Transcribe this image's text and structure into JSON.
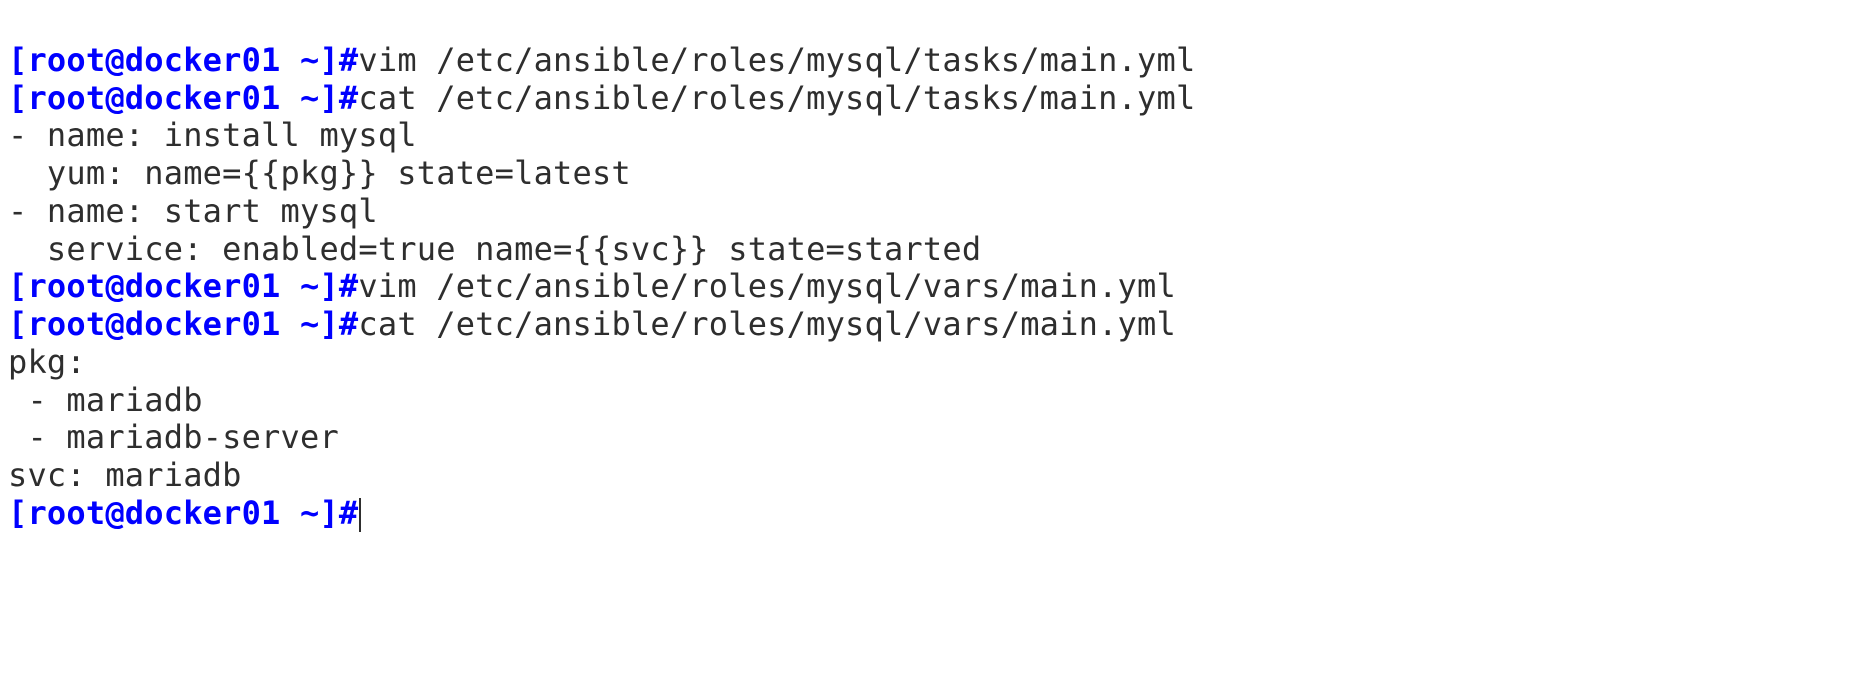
{
  "lines": [
    {
      "type": "cmd",
      "prompt": "[root@docker01 ~]#",
      "command": "vim /etc/ansible/roles/mysql/tasks/main.yml"
    },
    {
      "type": "cmd",
      "prompt": "[root@docker01 ~]#",
      "command": "cat /etc/ansible/roles/mysql/tasks/main.yml"
    },
    {
      "type": "out",
      "text": "- name: install mysql"
    },
    {
      "type": "out",
      "text": "  yum: name={{pkg}} state=latest"
    },
    {
      "type": "out",
      "text": "- name: start mysql"
    },
    {
      "type": "out",
      "text": "  service: enabled=true name={{svc}} state=started"
    },
    {
      "type": "cmd",
      "prompt": "[root@docker01 ~]#",
      "command": "vim /etc/ansible/roles/mysql/vars/main.yml"
    },
    {
      "type": "cmd",
      "prompt": "[root@docker01 ~]#",
      "command": "cat /etc/ansible/roles/mysql/vars/main.yml"
    },
    {
      "type": "out",
      "text": "pkg:"
    },
    {
      "type": "out",
      "text": " - mariadb"
    },
    {
      "type": "out",
      "text": " - mariadb-server"
    },
    {
      "type": "out",
      "text": "svc: mariadb"
    },
    {
      "type": "prompt_only",
      "prompt": "[root@docker01 ~]#"
    }
  ]
}
